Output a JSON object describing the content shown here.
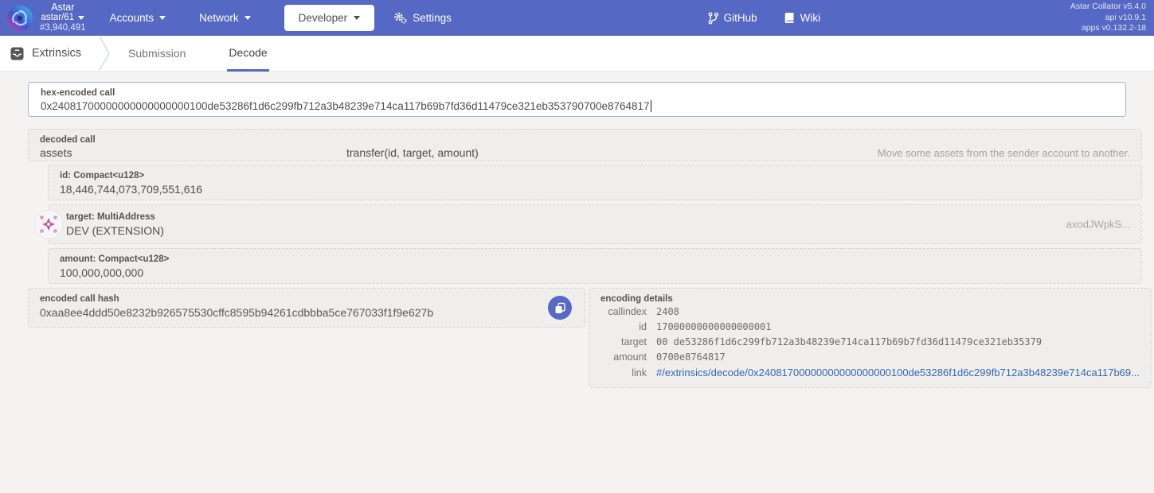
{
  "colors": {
    "header_bg": "#5568c4",
    "accent": "#5568c4",
    "link": "#3567b2",
    "copy_button": "#5569c5",
    "identicon_pink": "#c9519e",
    "panel_bg": "#efeeec"
  },
  "header": {
    "chain": {
      "name": "Astar",
      "node": "astar/61",
      "block": "#3,940,491"
    },
    "nav": {
      "accounts": "Accounts",
      "network": "Network",
      "developer": "Developer",
      "settings": "Settings"
    },
    "links": {
      "github": "GitHub",
      "wiki": "Wiki"
    },
    "versions": {
      "node": "Astar Collator v5.4.0",
      "api": "api v10.9.1",
      "apps": "apps v0.132.2-18"
    }
  },
  "tabbar": {
    "section": "Extrinsics",
    "tabs": {
      "submission": "Submission",
      "decode": "Decode"
    }
  },
  "decode": {
    "input": {
      "label": "hex-encoded call",
      "value": "0x24081700000000000000000100de53286f1d6c299fb712a3b48239e714ca117b69b7fd36d11479ce321eb353790700e8764817"
    },
    "call": {
      "label": "decoded call",
      "pallet": "assets",
      "method": "transfer(id, target, amount)",
      "doc": "Move some assets from the sender account to another."
    },
    "params": {
      "0": {
        "label": "id: Compact<u128>",
        "value": "18,446,744,073,709,551,616"
      },
      "1": {
        "label": "target: MultiAddress",
        "value": "DEV (EXTENSION)",
        "hint": "axodJWpkS..."
      },
      "2": {
        "label": "amount: Compact<u128>",
        "value": "100,000,000,000"
      }
    },
    "hash": {
      "label": "encoded call hash",
      "value": "0xaa8ee4ddd50e8232b926575530cffc8595b94261cdbbba5ce767033f1f9e627b"
    },
    "details": {
      "label": "encoding details",
      "rows": {
        "0": {
          "key": "callindex",
          "value": "2408"
        },
        "1": {
          "key": "id",
          "value": "17000000000000000001"
        },
        "2": {
          "key": "target",
          "value": "00  de53286f1d6c299fb712a3b48239e714ca117b69b7fd36d11479ce321eb35379"
        },
        "3": {
          "key": "amount",
          "value": "0700e8764817"
        },
        "4": {
          "key": "link",
          "value": "#/extrinsics/decode/0x24081700000000000000000100de53286f1d6c299fb712a3b48239e714ca117b69..."
        }
      }
    }
  }
}
